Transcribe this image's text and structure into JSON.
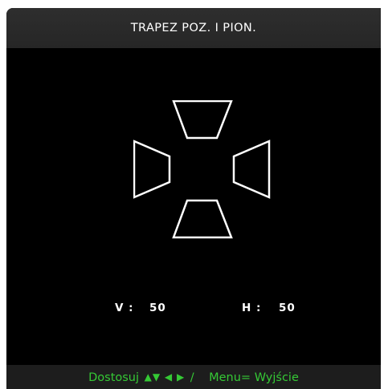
{
  "osd": {
    "title": "TRAPEZ POZ. I PION.",
    "vertical": {
      "label": "V :",
      "value": "50"
    },
    "horizontal": {
      "label": "H :",
      "value": "50"
    },
    "help": {
      "adjust_label": "Dostosuj",
      "arrows": "▲▼ ◀ ▶",
      "separator": "/",
      "menu_label": "Menu= Wyjście"
    },
    "colors": {
      "background": "#000000",
      "title_bar": "#2a2a2a",
      "help_bar": "#1d1d1d",
      "help_text": "#35c935",
      "text": "#ffffff"
    },
    "icons": {
      "top": "keystone-top-trapezoid-icon",
      "bottom": "keystone-bottom-trapezoid-icon",
      "left": "keystone-left-trapezoid-icon",
      "right": "keystone-right-trapezoid-icon"
    }
  }
}
